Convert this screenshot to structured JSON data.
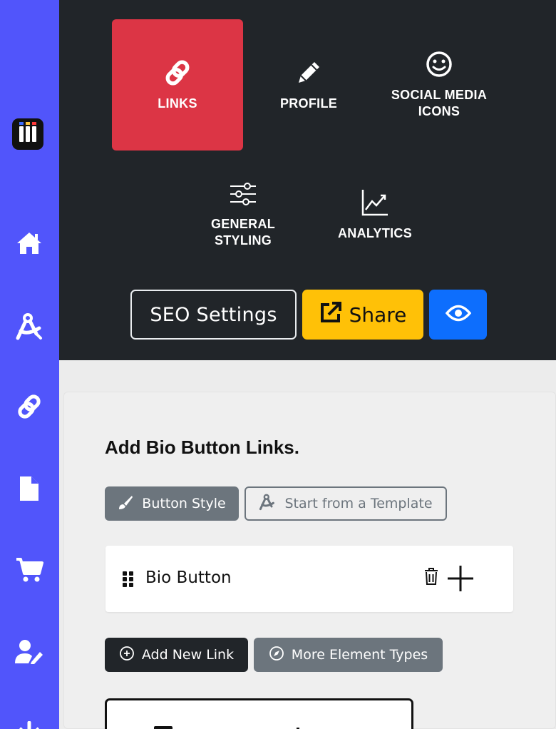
{
  "sidebar": {
    "items": [
      {
        "name": "logo",
        "icon": "app-logo-icon"
      },
      {
        "name": "home",
        "icon": "home-icon"
      },
      {
        "name": "design",
        "icon": "compass-drafting-icon"
      },
      {
        "name": "links",
        "icon": "link-icon"
      },
      {
        "name": "pages",
        "icon": "file-icon"
      },
      {
        "name": "shop",
        "icon": "cart-icon"
      },
      {
        "name": "account",
        "icon": "user-edit-icon"
      },
      {
        "name": "logout",
        "icon": "power-icon"
      }
    ],
    "color": "#5155fb"
  },
  "tabs": {
    "links": "LINKS",
    "profile": "PROFILE",
    "social_line1": "SOCIAL MEDIA",
    "social_line2": "ICONS",
    "general_line1": "GENERAL",
    "general_line2": "STYLING",
    "analytics": "ANALYTICS",
    "active": "LINKS"
  },
  "actions": {
    "seo": "SEO Settings",
    "share": "Share",
    "preview_icon": "eye-icon"
  },
  "editor": {
    "title": "Add Bio Button Links.",
    "button_style": "Button Style",
    "start_template": "Start from a Template",
    "link_item": "Bio Button",
    "add_new_link": "Add New Link",
    "more_element_types": "More Element Types"
  },
  "colors": {
    "active_tab": "#dc3545",
    "share": "#ffc107",
    "preview": "#0d6efd",
    "panel": "#212529",
    "secondary": "#6c757d"
  }
}
